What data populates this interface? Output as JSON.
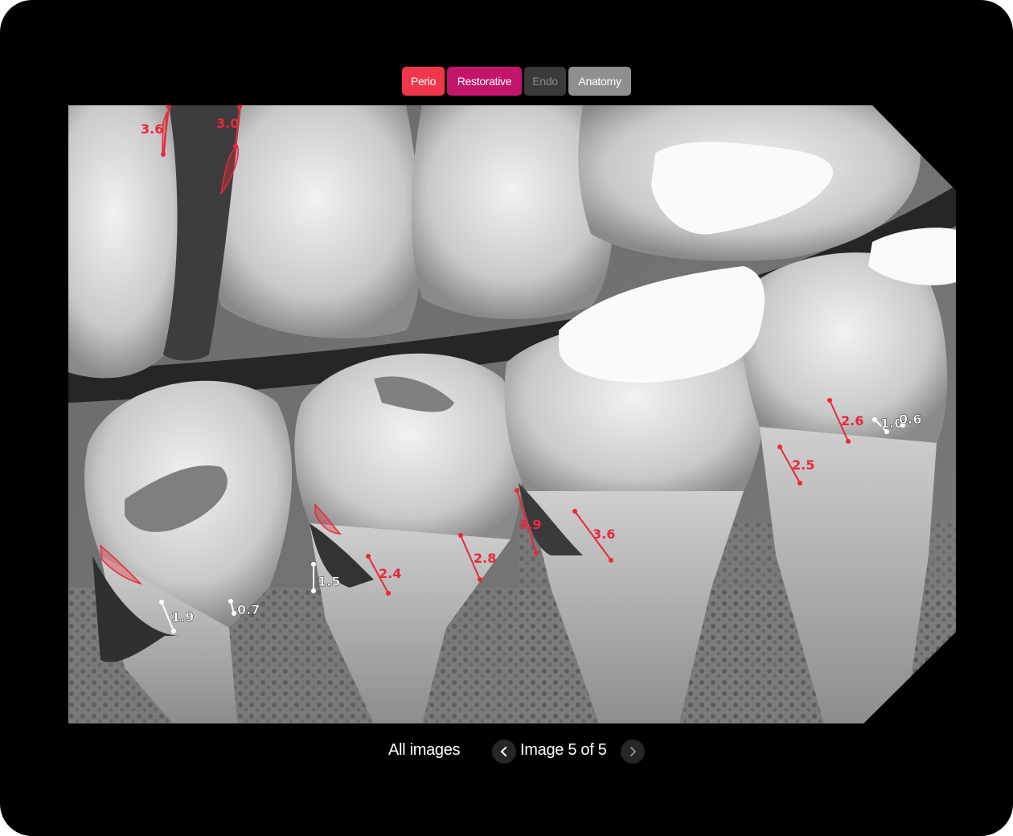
{
  "colors": {
    "perio": "#f0364b",
    "restorative": "#c2156b",
    "endo": "#3a3a3a",
    "anatomy": "#8f8f8f",
    "measure_red": "#e8283d",
    "measure_white": "#ffffff"
  },
  "tabs": [
    {
      "label": "Perio",
      "state": "active"
    },
    {
      "label": "Restorative",
      "state": "active"
    },
    {
      "label": "Endo",
      "state": "inactive"
    },
    {
      "label": "Anatomy",
      "state": "active"
    }
  ],
  "measurements": {
    "red": [
      "3.6",
      "3.0",
      "2.4",
      "2.8",
      "3.9",
      "3.6",
      "2.5",
      "2.6"
    ],
    "white": [
      "1.9",
      "0.7",
      "1.5",
      "1.0",
      "0.6"
    ]
  },
  "footer": {
    "all_images": "All images",
    "counter": "Image 5 of 5",
    "prev_icon": "chevron-left-icon",
    "next_icon": "chevron-right-icon"
  }
}
